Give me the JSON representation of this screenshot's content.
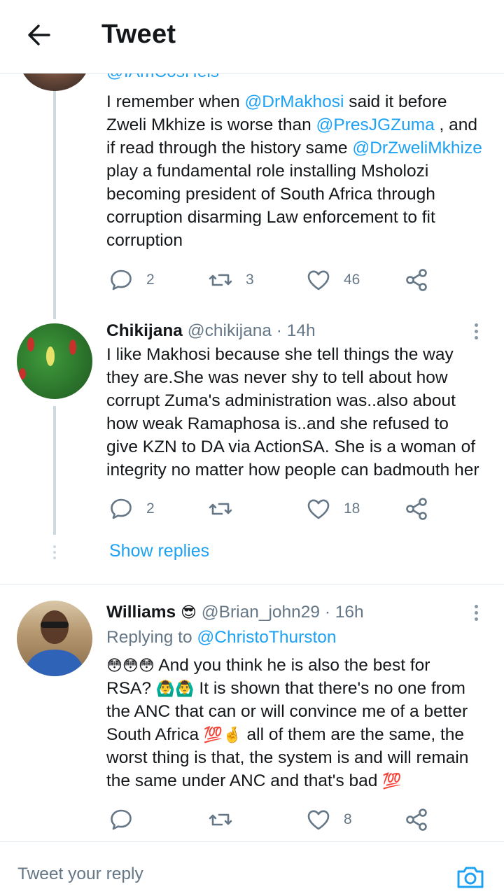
{
  "header": {
    "title": "Tweet"
  },
  "tweet1": {
    "handle_cut": "@IAmCosHels",
    "text_prefix_1": "I remember when ",
    "mention_1": "@DrMakhosi",
    "text_2": " said it before",
    "text_3": "Zweli Mkhize is worse than ",
    "mention_2": "@PresJGZuma",
    "text_4": " , and",
    "text_5": "if read through the history same ",
    "mention_3": "@DrZweliMkhize",
    "text_6": "play a fundamental role installing Msholozi",
    "text_7": "becoming president of South Africa through",
    "text_8": "corruption disarming Law enforcement to fit",
    "text_9": "corruption",
    "replies": "2",
    "retweets": "3",
    "likes": "46"
  },
  "tweet2": {
    "name": "Chikijana",
    "handle": "@chikijana",
    "time": "· 14h",
    "lines": [
      "I like Makhosi because she tell things the way",
      "they are.She was never shy to tell about how",
      "corrupt Zuma's administration was..also about",
      "how weak Ramaphosa is..and she refused to",
      "give KZN to DA via ActionSA. She is a woman of",
      "integrity no matter how people can badmouth her"
    ],
    "replies": "2",
    "retweets": "",
    "likes": "18"
  },
  "show_replies": "Show replies",
  "tweet3": {
    "name": "Williams",
    "name_emoji": "😎",
    "handle": "@Brian_john29",
    "time": "· 16h",
    "replying_to_label": "Replying to ",
    "replying_to_handle": "@ChristoThurston",
    "line1_emoji": "😳😳😳",
    "line1_text": " And you think he is also the best for",
    "line2_a": "RSA? ",
    "line2_emoji": "🙆‍♂️🙆‍♂️",
    "line2_b": " It is shown that there's no one from",
    "line3": "the ANC that can or will convince me of a better",
    "line4_a": "South Africa ",
    "line4_emoji": "💯🤞",
    "line4_b": " all of them are the same, the",
    "line5": "worst thing is that, the system is and will remain",
    "line6_a": "the same under ANC and that's bad ",
    "line6_emoji": "💯",
    "replies": "",
    "retweets": "",
    "likes": "8"
  },
  "reply_bar": {
    "placeholder": "Tweet your reply"
  },
  "colors": {
    "accent": "#1da1f2",
    "text": "#14171a",
    "muted": "#657786",
    "divider": "#e1e8ed"
  }
}
